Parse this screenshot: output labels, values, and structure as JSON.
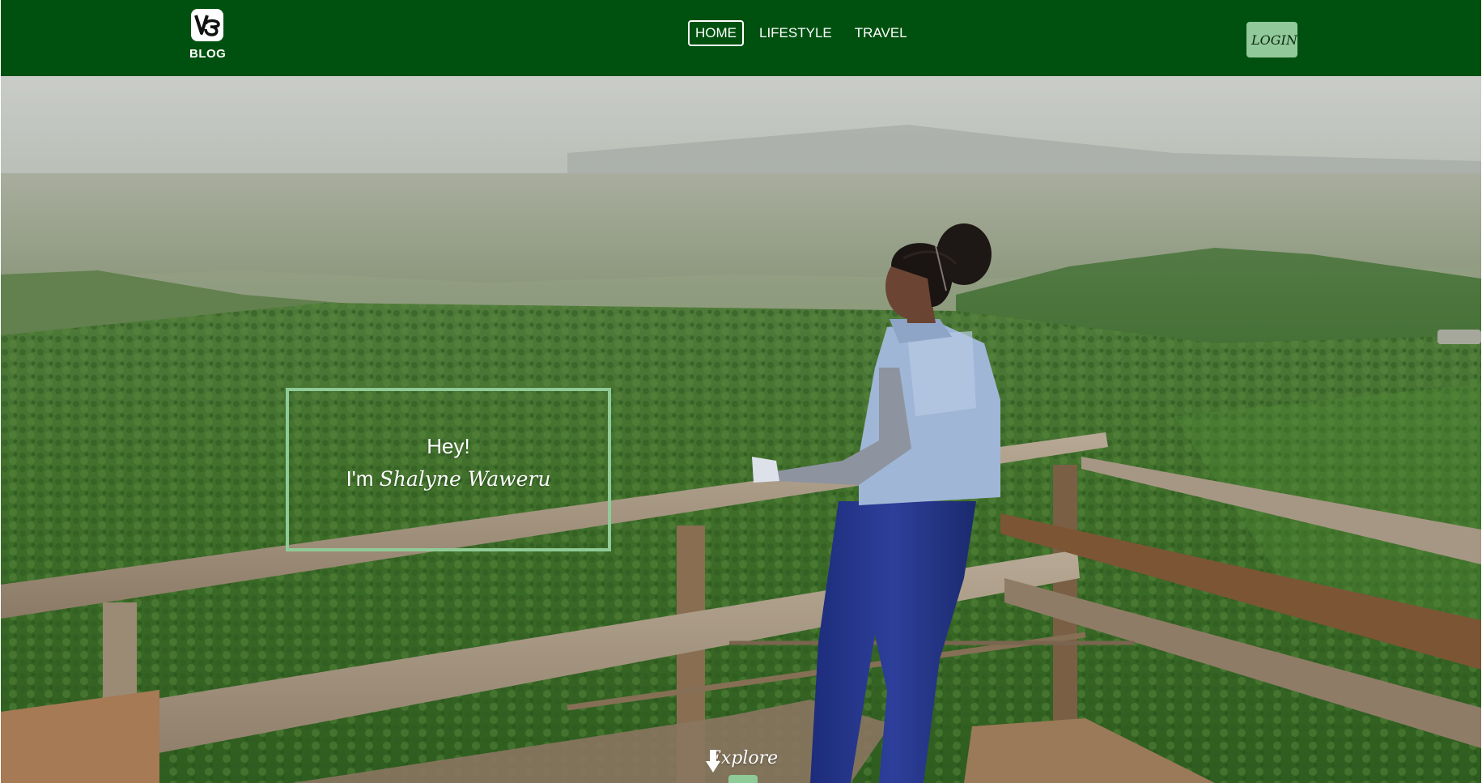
{
  "header": {
    "brand_label": "BLOG",
    "logo_icon": "vb-logo-icon",
    "nav": [
      {
        "label": "HOME",
        "active": true
      },
      {
        "label": "LIFESTYLE",
        "active": false
      },
      {
        "label": "TRAVEL",
        "active": false
      }
    ],
    "login_label": "LOGIN",
    "background": "#00510f",
    "login_color": "#92c99a"
  },
  "hero": {
    "greeting": "Hey!",
    "intro_prefix": "I'm",
    "name": "Shalyne Waweru",
    "box_border_color": "#8fcb97",
    "explore_label": "Explore",
    "explore_icon": "arrow-down-icon"
  }
}
